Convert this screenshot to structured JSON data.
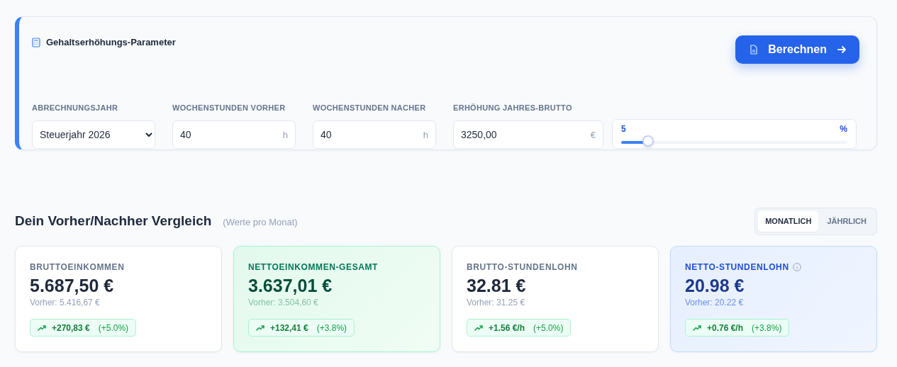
{
  "parameters": {
    "title": "Gehaltserhöhungs-Parameter",
    "calculate_button": "Berechnen",
    "fields": [
      {
        "kind": "select",
        "label": "ABRECHNUNGSJAHR",
        "value": "Steuerjahr 2026"
      },
      {
        "kind": "input",
        "label": "WOCHENSTUNDEN VORHER",
        "value": "40",
        "unit": "h"
      },
      {
        "kind": "input",
        "label": "WOCHENSTUNDEN NACHER",
        "value": "40",
        "unit": "h"
      },
      {
        "kind": "input",
        "label": "ERHÖHUNG JAHRES-BRUTTO",
        "value": "3250,00",
        "unit": "€"
      },
      {
        "kind": "slider",
        "value": "5",
        "unit": "%",
        "level": 0.12
      }
    ]
  },
  "comparison": {
    "title": "Dein Vorher/Nachher Vergleich",
    "subtitle": "(Werte pro Monat)",
    "period_tabs": [
      {
        "label": "MONATLICH",
        "selected": true
      },
      {
        "label": "JÄHRLICH",
        "selected": false
      }
    ],
    "cards": [
      {
        "kind": "plain",
        "label": "BRUTTOEINKOMMEN",
        "value": "5.687,50 €",
        "previous": "Vorher: 5.416,67 €",
        "change": "+270,83 €",
        "percent": "(+5.0%)",
        "info": false
      },
      {
        "kind": "green",
        "label": "NETTOEINKOMMEN-GESAMT",
        "value": "3.637,01 €",
        "previous": "Vorher: 3.504,60 €",
        "change": "+132,41 €",
        "percent": "(+3.8%)",
        "info": false
      },
      {
        "kind": "plain",
        "label": "BRUTTO-STUNDENLOHN",
        "value": "32.81 €",
        "previous": "Vorher: 31.25 €",
        "change": "+1.56 €/h",
        "percent": "(+5.0%)",
        "info": false
      },
      {
        "kind": "blue",
        "label": "NETTO-STUNDENLOHN",
        "value": "20.98 €",
        "previous": "Vorher: 20.22 €",
        "change": "+0.76 €/h",
        "percent": "(+3.8%)",
        "info": true
      }
    ]
  }
}
